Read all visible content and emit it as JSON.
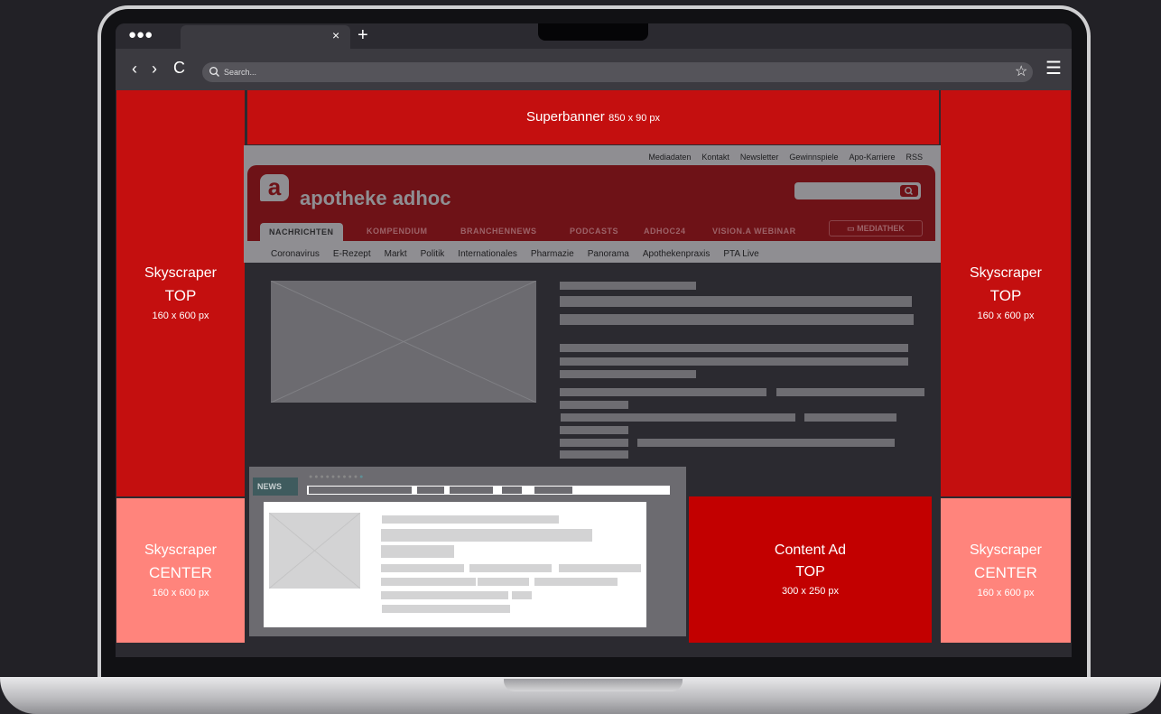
{
  "browser": {
    "window_controls": "●●●",
    "tab_close": "×",
    "new_tab": "+",
    "back": "‹",
    "forward": "›",
    "reload": "C",
    "search_placeholder": "Search...",
    "bookmark": "☆",
    "menu": "☰"
  },
  "ads": {
    "superbanner": {
      "name": "Superbanner",
      "size": "850 x 90 px"
    },
    "sky_top_left": {
      "line1": "Skyscraper",
      "line2": "TOP",
      "size": "160 x 600 px"
    },
    "sky_top_right": {
      "line1": "Skyscraper",
      "line2": "TOP",
      "size": "160 x 600 px"
    },
    "sky_center_left": {
      "line1": "Skyscraper",
      "line2": "CENTER",
      "size": "160 x 600 px"
    },
    "sky_center_right": {
      "line1": "Skyscraper",
      "line2": "CENTER",
      "size": "160 x 600 px"
    },
    "content_ad": {
      "line1": "Content Ad",
      "line2": "TOP",
      "size": "300 x 250 px"
    }
  },
  "site": {
    "meta_links": [
      "Mediadaten",
      "Kontakt",
      "Newsletter",
      "Gewinnspiele",
      "Apo-Karriere",
      "RSS"
    ],
    "logo_letter": "a",
    "brand": "apotheke adhoc",
    "main_nav": [
      "NACHRICHTEN",
      "KOMPENDIUM",
      "BRANCHENNEWS",
      "PODCASTS",
      "ADHOC24",
      "VISION.A WEBINAR"
    ],
    "mediathek": "MEDIATHEK",
    "sub_nav": [
      "Coronavirus",
      "E-Rezept",
      "Markt",
      "Politik",
      "Internationales",
      "Pharmazie",
      "Panorama",
      "Apothekenpraxis",
      "PTA Live"
    ],
    "news_label": "NEWS"
  },
  "colors": {
    "ad_red": "#c40f0f",
    "ad_pink": "#ff847c",
    "brand_dark_red": "#6e1217"
  }
}
